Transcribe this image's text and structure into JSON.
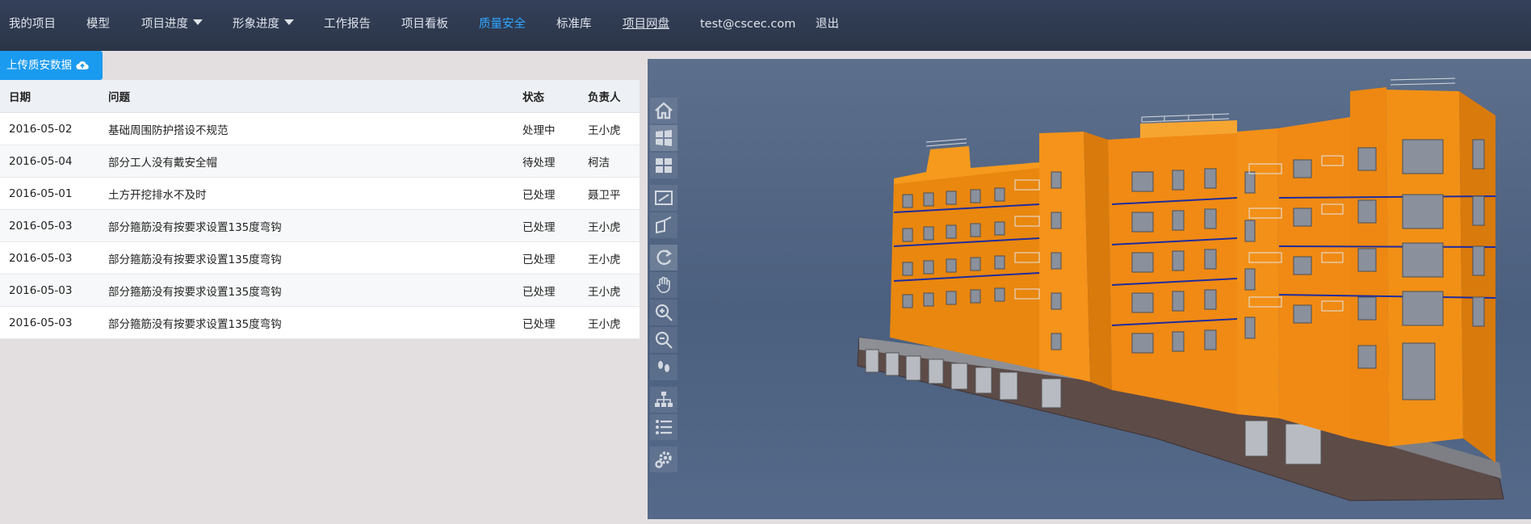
{
  "nav": {
    "items": [
      {
        "label": "我的项目"
      },
      {
        "label": "模型"
      },
      {
        "label": "项目进度"
      },
      {
        "label": "形象进度"
      },
      {
        "label": "工作报告"
      },
      {
        "label": "项目看板"
      },
      {
        "label": "质量安全",
        "active": true
      },
      {
        "label": "标准库"
      },
      {
        "label": "项目网盘"
      },
      {
        "label": "test@cscec.com"
      },
      {
        "label": "退出"
      }
    ],
    "colors": {
      "background": "#2c3748",
      "active": "#2ea6ff",
      "text": "#dfe4ea"
    }
  },
  "upload": {
    "label": "上传质安数据",
    "icon": "cloud-upload-icon"
  },
  "table": {
    "headers": {
      "date": "日期",
      "issue": "问题",
      "status": "状态",
      "owner": "负责人"
    },
    "rows": [
      {
        "date": "2016-05-02",
        "issue": "基础周围防护搭设不规范",
        "status": "处理中",
        "owner": "王小虎"
      },
      {
        "date": "2016-05-04",
        "issue": "部分工人没有戴安全帽",
        "status": "待处理",
        "owner": "柯洁"
      },
      {
        "date": "2016-05-01",
        "issue": "土方开挖排水不及时",
        "status": "已处理",
        "owner": "聂卫平"
      },
      {
        "date": "2016-05-03",
        "issue": "部分箍筋没有按要求设置135度弯钩",
        "status": "已处理",
        "owner": "王小虎"
      },
      {
        "date": "2016-05-03",
        "issue": "部分箍筋没有按要求设置135度弯钩",
        "status": "已处理",
        "owner": "王小虎"
      },
      {
        "date": "2016-05-03",
        "issue": "部分箍筋没有按要求设置135度弯钩",
        "status": "已处理",
        "owner": "王小虎"
      },
      {
        "date": "2016-05-03",
        "issue": "部分箍筋没有按要求设置135度弯钩",
        "status": "已处理",
        "owner": "王小虎"
      }
    ]
  },
  "viewer": {
    "tools": [
      "home-icon",
      "window-icon",
      "grid-icon",
      "fit-icon",
      "camera-icon",
      "rotate-icon",
      "pan-icon",
      "zoom-in-icon",
      "zoom-out-icon",
      "walk-icon",
      "tree-icon",
      "list-icon",
      "settings-icon"
    ],
    "colors": {
      "background": "#4f6382",
      "building": "#f08a14"
    }
  }
}
